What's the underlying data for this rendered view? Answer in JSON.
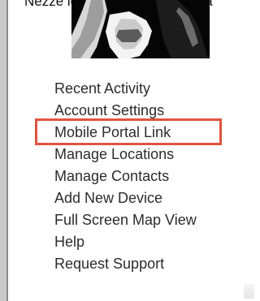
{
  "caption": {
    "text": "Nézze lépésenként kinnetjen a"
  },
  "profile": {
    "avatar_icon": "user-photo"
  },
  "menu": {
    "items": [
      {
        "label": "Recent Activity"
      },
      {
        "label": "Account Settings"
      },
      {
        "label": "Mobile Portal Link"
      },
      {
        "label": "Manage Locations"
      },
      {
        "label": "Manage Contacts"
      },
      {
        "label": "Add New Device"
      },
      {
        "label": "Full Screen Map View"
      },
      {
        "label": "Help"
      },
      {
        "label": "Request Support"
      }
    ],
    "highlighted_label": "Mobile Portal Link"
  },
  "colors": {
    "highlight": "#e0533f",
    "text": "#2c2c2c",
    "avatar_bg": "#050505",
    "rail": "#c9c9c9"
  }
}
